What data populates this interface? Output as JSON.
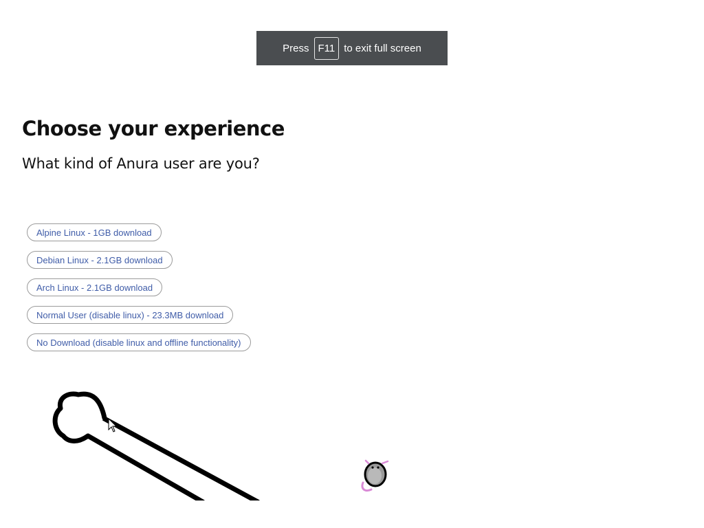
{
  "fullscreen_notice": {
    "prefix": "Press",
    "key": "F11",
    "suffix": "to exit full screen"
  },
  "heading": {
    "title": "Choose your experience",
    "subtitle": "What kind of Anura user are you?"
  },
  "options": [
    {
      "label": "Alpine Linux - 1GB download"
    },
    {
      "label": "Debian Linux - 2.1GB download"
    },
    {
      "label": "Arch Linux - 2.1GB download"
    },
    {
      "label": "Normal User (disable linux) - 23.3MB download"
    },
    {
      "label": "No Download (disable linux and offline functionality)"
    }
  ],
  "colors": {
    "toast_bg": "#4a4d50",
    "button_text": "#3f5ca8",
    "button_border": "#9a9a9a",
    "mascot_accent": "#d98ad6"
  },
  "icons": {
    "bone": "bone-drawing-icon",
    "mascot": "frog-mascot-icon",
    "cursor": "mouse-pointer-icon"
  }
}
